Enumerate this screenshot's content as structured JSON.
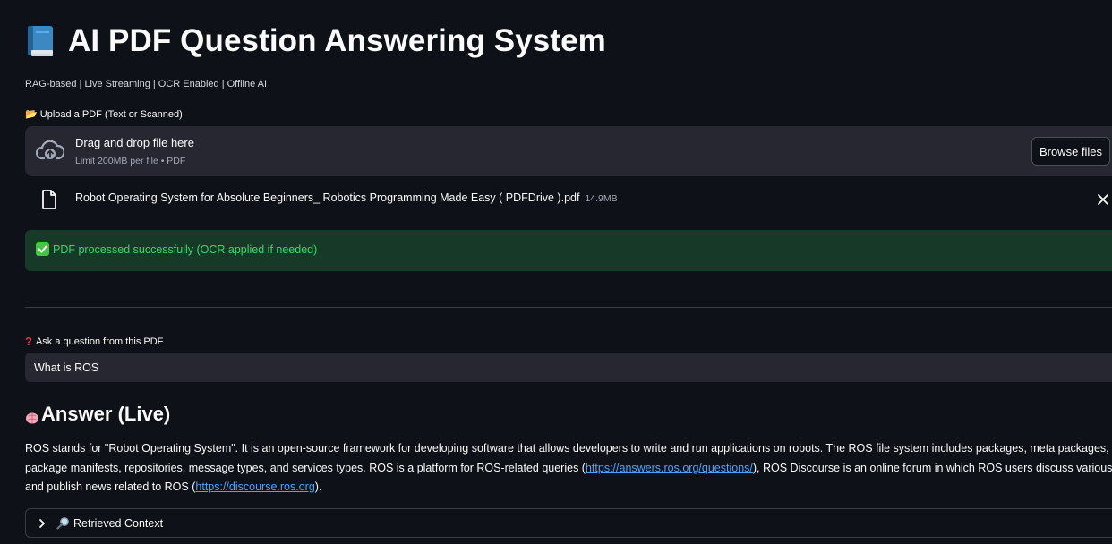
{
  "header": {
    "title": "AI PDF Question Answering System",
    "title_icon": "blue-book-icon",
    "subtitle": "RAG-based | Live Streaming | OCR Enabled | Offline AI"
  },
  "upload": {
    "label_icon": "open-folder-icon",
    "label": "Upload a PDF (Text or Scanned)",
    "dropzone_icon": "cloud-upload-icon",
    "dropzone_title": "Drag and drop file here",
    "dropzone_limit": "Limit 200MB per file • PDF",
    "browse_label": "Browse files"
  },
  "uploaded_file": {
    "icon": "file-icon",
    "name": "Robot Operating System for Absolute Beginners_ Robotics Programming Made Easy ( PDFDrive ).pdf",
    "size": "14.9MB",
    "remove_icon": "close-icon"
  },
  "status": {
    "icon": "check-mark-icon",
    "message": "PDF processed successfully (OCR applied if needed)",
    "color": "#3dd56d"
  },
  "question": {
    "label_icon": "question-mark-icon",
    "label": "Ask a question from this PDF",
    "value": "What is ROS"
  },
  "answer": {
    "heading_icon": "brain-icon",
    "heading": "Answer (Live)",
    "line1": "ROS stands for \"Robot Operating System\". It is an open-source framework for developing software that allows developers to write and run applications on robots. The ROS file system includes packages, meta packages,",
    "line2_pre": "package manifests, repositories, message types, and services types. ROS is a platform for ROS-related queries (",
    "link1": "https://answers.ros.org/questions/",
    "line2_post": "), ROS Discourse is an online forum in which ROS users discuss various topics",
    "line3_pre": "and publish news related to ROS (",
    "link2": "https://discourse.ros.org",
    "line3_post": ")."
  },
  "context_expander": {
    "chevron_icon": "chevron-right-icon",
    "icon": "magnifier-icon",
    "label": "Retrieved Context"
  },
  "colors": {
    "background": "#0e1117",
    "panel": "#262730",
    "success_bg": "#173928",
    "link": "#4da3ff"
  }
}
